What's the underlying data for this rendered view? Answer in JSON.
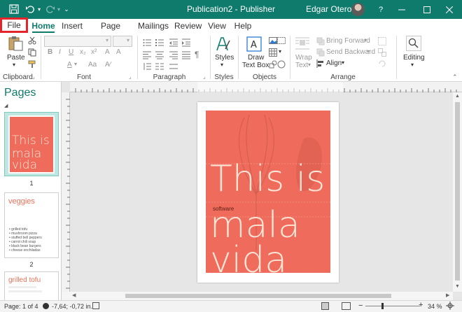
{
  "app": {
    "title": "Publication2 - Publisher",
    "user": "Edgar Otero",
    "help": "?"
  },
  "tabs": [
    {
      "name": "File"
    },
    {
      "name": "Home"
    },
    {
      "name": "Insert"
    },
    {
      "name": "Page Design"
    },
    {
      "name": "Mailings"
    },
    {
      "name": "Review"
    },
    {
      "name": "View"
    },
    {
      "name": "Help"
    }
  ],
  "ribbon": {
    "clipboard": {
      "label": "Clipboard",
      "paste": "Paste"
    },
    "font": {
      "label": "Font"
    },
    "paragraph": {
      "label": "Paragraph"
    },
    "styles": {
      "label": "Styles",
      "button": "Styles"
    },
    "objects": {
      "label": "Objects",
      "draw_line1": "Draw",
      "draw_line2": "Text Box"
    },
    "arrange": {
      "label": "Arrange",
      "wrap_line1": "Wrap",
      "wrap_line2": "Text",
      "bring_forward": "Bring Forward",
      "send_backward": "Send Backward",
      "align": "Align"
    },
    "editing": {
      "button": "Editing"
    }
  },
  "pages_panel": {
    "title": "Pages",
    "thumbs": [
      {
        "num": "1",
        "line1": "This is",
        "line2": "mala",
        "line3": "vida"
      },
      {
        "num": "2",
        "heading": "veggies",
        "items": [
          "grilled tofu",
          "mushroom pizza",
          "stuffed bell peppers",
          "carrot chili soup",
          "black bean burgers",
          "cheese enchiladas"
        ]
      },
      {
        "heading": "grilled tofu"
      }
    ]
  },
  "poster": {
    "line1": "This is",
    "small": "software",
    "line2": "mala",
    "line3": "vida",
    "bg_color": "#ef6c5c",
    "text_color": "#fbe4d6"
  },
  "status": {
    "page": "Page: 1 of 4",
    "position": "-7,64; -0,72 in.",
    "zoom": "34 %"
  },
  "colors": {
    "accent": "#0f7b6c",
    "file_highlight": "#e2262b"
  }
}
